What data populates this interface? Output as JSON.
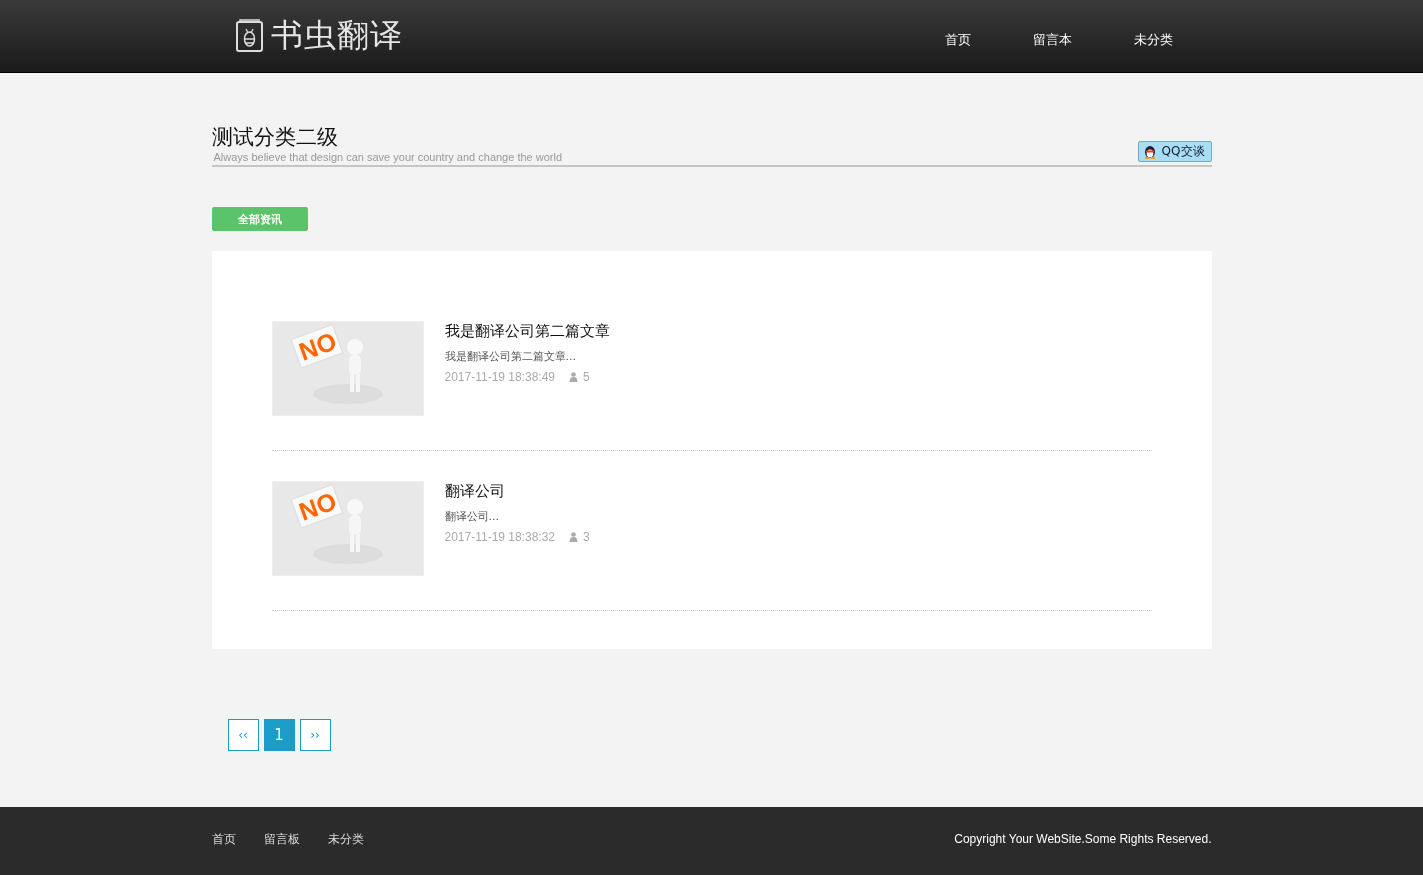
{
  "header": {
    "logo": "书虫翻译",
    "nav": [
      {
        "label": "首页"
      },
      {
        "label": "留言本"
      },
      {
        "label": "未分类"
      }
    ]
  },
  "page": {
    "title": "测试分类二级",
    "subtitle": "Always believe that design can save your country and change the world",
    "qq_button": "QQ交谈"
  },
  "filter_button": "全部资讯",
  "articles": [
    {
      "title": "我是翻译公司第二篇文章",
      "excerpt": "我是翻译公司第二篇文章...",
      "date": "2017-11-19 18:38:49",
      "views": "5",
      "thumb_text": "NO"
    },
    {
      "title": "翻译公司",
      "excerpt": "翻译公司...",
      "date": "2017-11-19 18:38:32",
      "views": "3",
      "thumb_text": "NO"
    }
  ],
  "pagination": [
    {
      "label": "‹‹",
      "selected": false
    },
    {
      "label": "1",
      "selected": true
    },
    {
      "label": "››",
      "selected": false
    }
  ],
  "footer": {
    "links": [
      {
        "label": "首页"
      },
      {
        "label": "留言板"
      },
      {
        "label": "未分类"
      }
    ],
    "copyright": "Copyright Your WebSite.Some Rights Reserved."
  }
}
